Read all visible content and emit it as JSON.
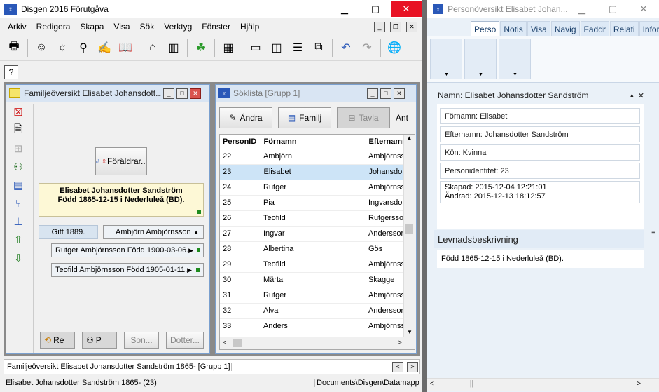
{
  "main": {
    "title": "Disgen 2016 Förutgåva",
    "menu": [
      "Arkiv",
      "Redigera",
      "Skapa",
      "Visa",
      "Sök",
      "Verktyg",
      "Fönster",
      "Hjälp"
    ]
  },
  "family": {
    "title": "Familjeöversikt Elisabet Johansdott...",
    "parents_btn": "Föräldrar...",
    "person_line1": "Elisabet Johansdotter Sandström",
    "person_line2": "Född 1865-12-15 i Nederluleå (BD).",
    "married": "Gift 1889.",
    "spouse": "Ambjörn Ambjörnsson",
    "children": [
      "Rutger Ambjörnsson Född 1900-03-06.",
      "Teofild Ambjörnsson Född 1905-01-11."
    ],
    "bottom": [
      "Re",
      "P",
      "Son...",
      "Dotter..."
    ]
  },
  "search": {
    "title": "Söklista [Grupp 1]",
    "buttons": [
      "Ändra",
      "Familj",
      "Tavla",
      "Ant"
    ],
    "columns": [
      "PersonID",
      "Förnamn",
      "Efternamn"
    ],
    "rows": [
      [
        "22",
        "Ambjörn",
        "Ambjörnss"
      ],
      [
        "23",
        "Elisabet",
        "Johansdo"
      ],
      [
        "24",
        "Rutger",
        "Ambjörnss"
      ],
      [
        "25",
        "Pia",
        "Ingvarsdo"
      ],
      [
        "26",
        "Teofild",
        "Rutgersso"
      ],
      [
        "27",
        "Ingvar",
        "Anderssor"
      ],
      [
        "28",
        "Albertina",
        "Gös"
      ],
      [
        "29",
        "Teofild",
        "Ambjörnss"
      ],
      [
        "30",
        "Märta",
        "Skagge"
      ],
      [
        "31",
        "Rutger",
        "Abmjörnss"
      ],
      [
        "32",
        "Alva",
        "Anderssor"
      ],
      [
        "33",
        "Anders",
        "Ambjörnss"
      ]
    ]
  },
  "status": {
    "tab_label": "Familjeöversikt Elisabet Johansdotter Sandström 1865- [Grupp 1]",
    "left": "Elisabet Johansdotter Sandström 1865- (23)",
    "right": "Documents\\Disgen\\Datamapp"
  },
  "person": {
    "title": "Personöversikt Elisabet Johan...",
    "tabs": [
      "Perso",
      "Notis",
      "Visa",
      "Navig",
      "Faddr",
      "Relati",
      "Inform"
    ],
    "name_header": "Namn: Elisabet Johansdotter Sandström",
    "fields": [
      "Förnamn: Elisabet",
      "Efternamn: Johansdotter Sandström",
      "Kön: Kvinna",
      "Personidentitet: 23"
    ],
    "created": "Skapad: 2015-12-04 12:21:01",
    "changed": "Ändrad: 2015-12-13 18:12:57",
    "life_header": "Levnadsbeskrivning",
    "life_text": "Född 1865-12-15 i Nederluleå (BD)."
  }
}
